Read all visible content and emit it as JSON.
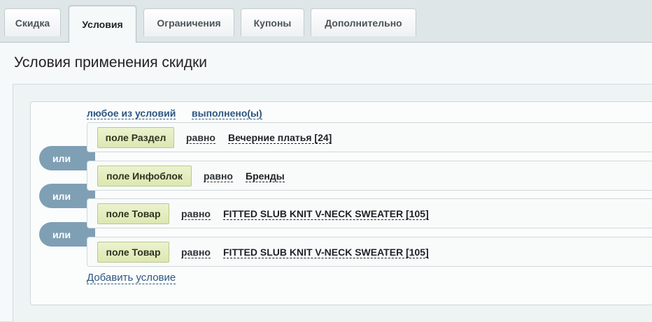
{
  "tabs": [
    {
      "label": "Скидка",
      "active": false
    },
    {
      "label": "Условия",
      "active": true
    },
    {
      "label": "Ограничения",
      "active": false
    },
    {
      "label": "Купоны",
      "active": false
    },
    {
      "label": "Дополнительно",
      "active": false
    }
  ],
  "title": "Условия применения скидки",
  "logic": {
    "mode": "любое из условий",
    "state": "выполнено(ы)"
  },
  "or_label": "или",
  "conditions": [
    {
      "field": "поле Раздел",
      "operator": "равно",
      "value": "Вечерние платья [24]"
    },
    {
      "field": "поле Инфоблок",
      "operator": "равно",
      "value": "Бренды"
    },
    {
      "field": "поле Товар",
      "operator": "равно",
      "value": "FITTED SLUB KNIT V-NECK SWEATER [105]"
    },
    {
      "field": "поле Товар",
      "operator": "равно",
      "value": "FITTED SLUB KNIT V-NECK SWEATER [105]"
    }
  ],
  "add_condition": "Добавить условие",
  "colors": {
    "accent_link": "#2c5680",
    "field_button": "#dde7b1",
    "or_pill": "#7f9fb5"
  }
}
